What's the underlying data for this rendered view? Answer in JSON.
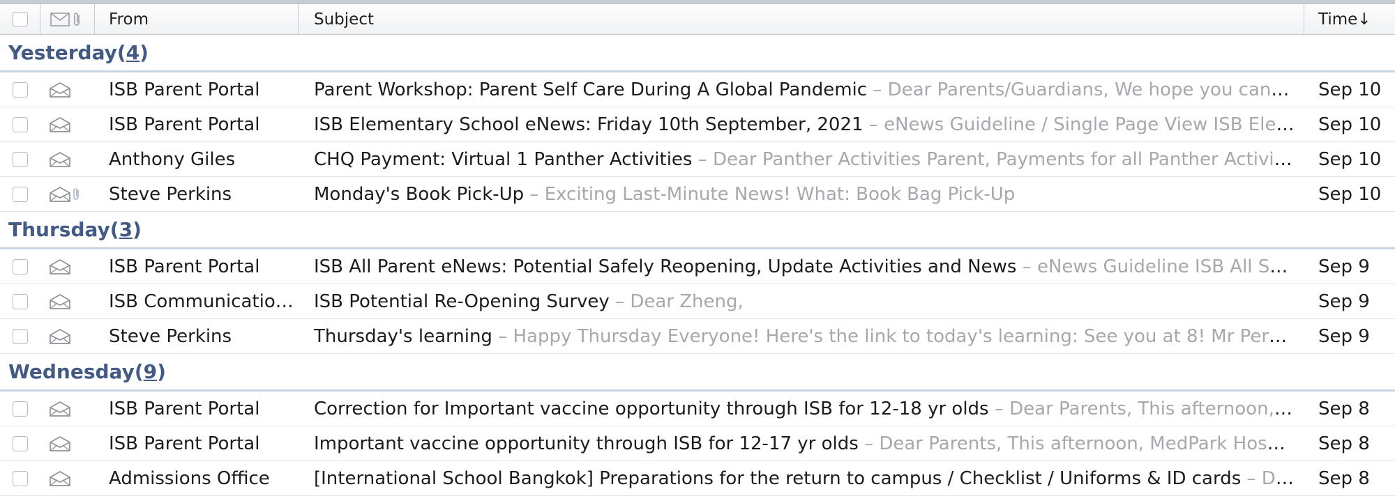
{
  "header": {
    "from_label": "From",
    "subject_label": "Subject",
    "time_label": "Time↓"
  },
  "preview_separator": " – ",
  "groups": [
    {
      "name": "Yesterday",
      "count": "4",
      "rows": [
        {
          "from": "ISB Parent Portal",
          "subject": "Parent Workshop: Parent Self Care During A Global Pandemic",
          "preview": " Dear Parents/Guardians, We hope you can join us for a special workshop",
          "time": "Sep 10",
          "attachment": false
        },
        {
          "from": "ISB Parent Portal",
          "subject": "ISB Elementary School eNews: Friday 10th September, 2021",
          "preview": " eNews Guideline / Single Page View ISB Elementary School eNews",
          "time": "Sep 10",
          "attachment": false
        },
        {
          "from": "Anthony Giles",
          "subject": "CHQ Payment: Virtual 1 Panther Activities",
          "preview": "Dear Panther Activities Parent, Payments for all Panther Activities are due",
          "time": "Sep 10",
          "attachment": false
        },
        {
          "from": "Steve Perkins",
          "subject": "Monday's Book Pick-Up",
          "preview": "Exciting Last-Minute News! What: Book Bag Pick-Up",
          "time": "Sep 10",
          "attachment": true
        }
      ]
    },
    {
      "name": "Thursday",
      "count": "3",
      "rows": [
        {
          "from": "ISB Parent Portal",
          "subject": "ISB All Parent eNews: Potential Safely Reopening, Update Activities and News",
          "preview": " eNews Guideline ISB All School eNews",
          "time": "Sep 9",
          "attachment": false
        },
        {
          "from": "ISB Communications Office",
          "subject": "ISB Potential Re-Opening Survey",
          "preview": "Dear Zheng,",
          "time": "Sep 9",
          "attachment": false
        },
        {
          "from": "Steve Perkins",
          "subject": "Thursday's learning",
          "preview": "Happy Thursday Everyone! Here's the link to today's learning: See you at 8! Mr Perkins and team",
          "time": "Sep 9",
          "attachment": false
        }
      ]
    },
    {
      "name": "Wednesday",
      "count": "9",
      "rows": [
        {
          "from": "ISB Parent Portal",
          "subject": "Correction for Important vaccine opportunity through ISB for 12-18 yr olds",
          "preview": " Dear Parents, This afternoon, MedPark Hospital",
          "time": "Sep 8",
          "attachment": false
        },
        {
          "from": "ISB Parent Portal",
          "subject": "Important vaccine opportunity through ISB for 12-17 yr olds",
          "preview": "Dear Parents, This afternoon, MedPark Hospital has announced",
          "time": "Sep 8",
          "attachment": false
        },
        {
          "from": "Admissions Office",
          "subject": "[International School Bangkok] Preparations for the return to campus / Checklist / Uniforms & ID cards",
          "preview": "Dear Parents",
          "time": "Sep 8",
          "attachment": false
        }
      ]
    }
  ]
}
